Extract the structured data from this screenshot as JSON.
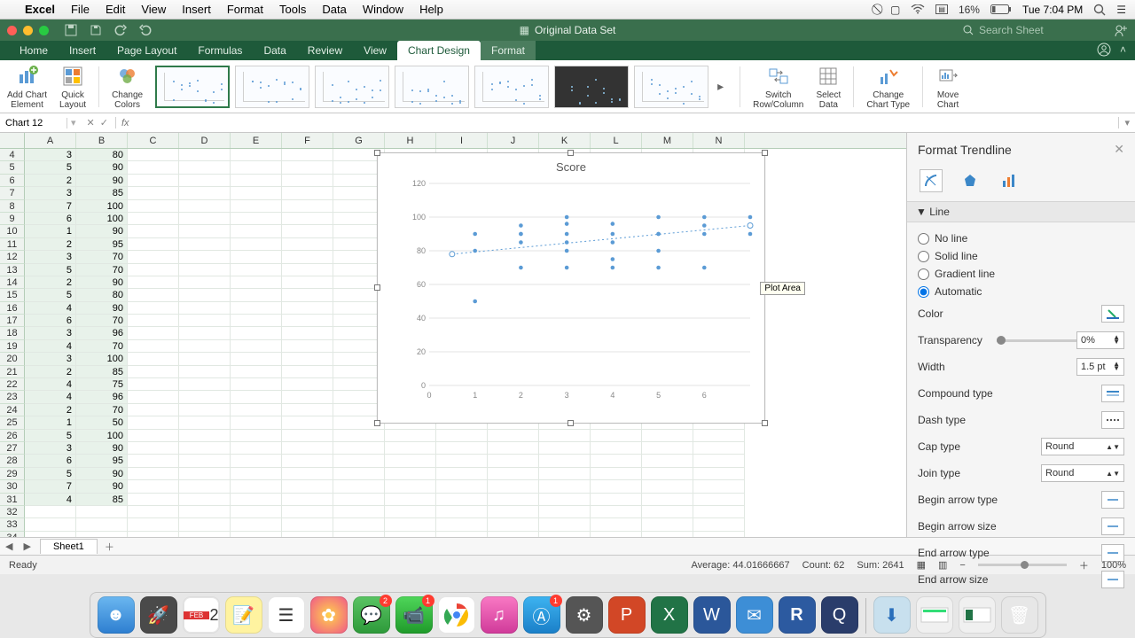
{
  "mac_menu": {
    "app": "Excel",
    "items": [
      "File",
      "Edit",
      "View",
      "Insert",
      "Format",
      "Tools",
      "Data",
      "Window",
      "Help"
    ],
    "battery": "16%",
    "clock": "Tue 7:04 PM"
  },
  "titlebar": {
    "doc": "Original Data Set",
    "search_placeholder": "Search Sheet"
  },
  "ribbon_tabs": [
    "Home",
    "Insert",
    "Page Layout",
    "Formulas",
    "Data",
    "Review",
    "View",
    "Chart Design",
    "Format"
  ],
  "ribbon_active": "Chart Design",
  "ribbon_btns": {
    "add_chart_element": "Add Chart\nElement",
    "quick_layout": "Quick\nLayout",
    "change_colors": "Change\nColors",
    "switch": "Switch\nRow/Column",
    "select_data": "Select\nData",
    "change_type": "Change\nChart Type",
    "move_chart": "Move\nChart"
  },
  "namebox": "Chart 12",
  "columns": [
    "A",
    "B",
    "C",
    "D",
    "E",
    "F",
    "G",
    "H",
    "I",
    "J",
    "K",
    "L",
    "M",
    "N"
  ],
  "rows": [
    {
      "r": 4,
      "a": 3,
      "b": 80
    },
    {
      "r": 5,
      "a": 5,
      "b": 90
    },
    {
      "r": 6,
      "a": 2,
      "b": 90
    },
    {
      "r": 7,
      "a": 3,
      "b": 85
    },
    {
      "r": 8,
      "a": 7,
      "b": 100
    },
    {
      "r": 9,
      "a": 6,
      "b": 100
    },
    {
      "r": 10,
      "a": 1,
      "b": 90
    },
    {
      "r": 11,
      "a": 2,
      "b": 95
    },
    {
      "r": 12,
      "a": 3,
      "b": 70
    },
    {
      "r": 13,
      "a": 5,
      "b": 70
    },
    {
      "r": 14,
      "a": 2,
      "b": 90
    },
    {
      "r": 15,
      "a": 5,
      "b": 80
    },
    {
      "r": 16,
      "a": 4,
      "b": 90
    },
    {
      "r": 17,
      "a": 6,
      "b": 70
    },
    {
      "r": 18,
      "a": 3,
      "b": 96
    },
    {
      "r": 19,
      "a": 4,
      "b": 70
    },
    {
      "r": 20,
      "a": 3,
      "b": 100
    },
    {
      "r": 21,
      "a": 2,
      "b": 85
    },
    {
      "r": 22,
      "a": 4,
      "b": 75
    },
    {
      "r": 23,
      "a": 4,
      "b": 96
    },
    {
      "r": 24,
      "a": 2,
      "b": 70
    },
    {
      "r": 25,
      "a": 1,
      "b": 50
    },
    {
      "r": 26,
      "a": 5,
      "b": 100
    },
    {
      "r": 27,
      "a": 3,
      "b": 90
    },
    {
      "r": 28,
      "a": 6,
      "b": 95
    },
    {
      "r": 29,
      "a": 5,
      "b": 90
    },
    {
      "r": 30,
      "a": 7,
      "b": 90
    },
    {
      "r": 31,
      "a": 4,
      "b": 85
    },
    {
      "r": 32,
      "a": "",
      "b": ""
    },
    {
      "r": 33,
      "a": "",
      "b": ""
    },
    {
      "r": 34,
      "a": "",
      "b": ""
    }
  ],
  "chart_tooltip": "Plot Area",
  "sidepanel": {
    "title": "Format Trendline",
    "section": "Line",
    "radios": [
      "No line",
      "Solid line",
      "Gradient line",
      "Automatic"
    ],
    "radio_selected": "Automatic",
    "props": {
      "color": "Color",
      "transparency": "Transparency",
      "transparency_val": "0%",
      "width": "Width",
      "width_val": "1.5 pt",
      "compound": "Compound type",
      "dash": "Dash type",
      "cap": "Cap type",
      "cap_val": "Round",
      "join": "Join type",
      "join_val": "Round",
      "begin_arrow_type": "Begin arrow type",
      "begin_arrow_size": "Begin arrow size",
      "end_arrow_type": "End arrow type",
      "end_arrow_size": "End arrow size"
    }
  },
  "sheettab": "Sheet1",
  "status": {
    "ready": "Ready",
    "avg_lbl": "Average:",
    "avg": "44.01666667",
    "count_lbl": "Count:",
    "count": "62",
    "sum_lbl": "Sum:",
    "sum": "2641",
    "zoom": "100%"
  },
  "chart_data": {
    "type": "scatter",
    "title": "Score",
    "xlabel": "",
    "ylabel": "",
    "xlim": [
      0,
      7
    ],
    "ylim": [
      0,
      120
    ],
    "xticks": [
      0,
      1,
      2,
      3,
      4,
      5,
      6
    ],
    "yticks": [
      0,
      20,
      40,
      60,
      80,
      100,
      120
    ],
    "series": [
      {
        "name": "Score",
        "points": [
          [
            3,
            80
          ],
          [
            5,
            90
          ],
          [
            2,
            90
          ],
          [
            3,
            85
          ],
          [
            7,
            100
          ],
          [
            6,
            100
          ],
          [
            1,
            90
          ],
          [
            2,
            95
          ],
          [
            3,
            70
          ],
          [
            5,
            70
          ],
          [
            2,
            90
          ],
          [
            5,
            80
          ],
          [
            4,
            90
          ],
          [
            6,
            70
          ],
          [
            3,
            96
          ],
          [
            4,
            70
          ],
          [
            3,
            100
          ],
          [
            2,
            85
          ],
          [
            4,
            75
          ],
          [
            4,
            96
          ],
          [
            2,
            70
          ],
          [
            1,
            50
          ],
          [
            5,
            100
          ],
          [
            3,
            90
          ],
          [
            6,
            95
          ],
          [
            5,
            90
          ],
          [
            7,
            90
          ],
          [
            4,
            85
          ],
          [
            1,
            80
          ],
          [
            6,
            90
          ],
          [
            7,
            95
          ]
        ]
      }
    ],
    "trendline": {
      "type": "linear",
      "p1": [
        0.5,
        78
      ],
      "p2": [
        7,
        95
      ]
    }
  }
}
